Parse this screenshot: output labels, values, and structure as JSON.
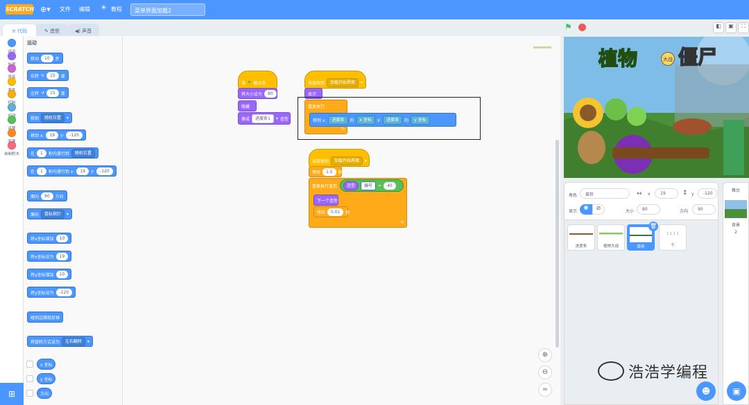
{
  "menubar": {
    "logo": "SCRATCH",
    "file": "文件",
    "edit": "编辑",
    "tutorials": "教程",
    "project_title": "菜单界面加载2"
  },
  "tabs": {
    "code": "代码",
    "costumes": "造型",
    "sounds": "声音"
  },
  "categories": [
    {
      "label": "运动",
      "color": "#4c97ff"
    },
    {
      "label": "外观",
      "color": "#9966ff"
    },
    {
      "label": "声音",
      "color": "#cf63cf"
    },
    {
      "label": "事件",
      "color": "#ffbf00"
    },
    {
      "label": "控制",
      "color": "#ffab19"
    },
    {
      "label": "侦测",
      "color": "#5cb1d6"
    },
    {
      "label": "运算",
      "color": "#59c059"
    },
    {
      "label": "变量",
      "color": "#ff8c1a"
    },
    {
      "label": "自制积木",
      "color": "#ff6680"
    }
  ],
  "palette": {
    "heading": "运动",
    "move": {
      "a": "移动",
      "v": "10",
      "b": "步"
    },
    "turn_r": {
      "a": "右转",
      "v": "15",
      "b": "度"
    },
    "turn_l": {
      "a": "左转",
      "v": "15",
      "b": "度"
    },
    "goto": {
      "a": "移到",
      "dd": "随机位置"
    },
    "goto_xy": {
      "a": "移到 x:",
      "x": "19",
      "b": "y:",
      "y": "-120"
    },
    "glide": {
      "a": "在",
      "v": "1",
      "b": "秒内滑行到",
      "dd": "随机位置"
    },
    "glide_xy": {
      "a": "在",
      "v": "1",
      "b": "秒内滑行到 x:",
      "x": "19",
      "c": "y:",
      "y": "-120"
    },
    "point": {
      "a": "面向",
      "v": "90",
      "b": "方向"
    },
    "point_to": {
      "a": "面向",
      "dd": "鼠标指针"
    },
    "change_x": {
      "a": "将x坐标增加",
      "v": "10"
    },
    "set_x": {
      "a": "将x坐标设为",
      "v": "19"
    },
    "change_y": {
      "a": "将y坐标增加",
      "v": "10"
    },
    "set_y": {
      "a": "将y坐标设为",
      "v": "-120"
    },
    "bounce": "碰到边缘就反弹",
    "rotation": {
      "a": "将旋转方式设为",
      "dd": "左右翻转"
    },
    "rep_x": "x 坐标",
    "rep_y": "y 坐标",
    "rep_dir": "方向"
  },
  "scripts": {
    "s1": {
      "hat": "当",
      "hat2": "被点击",
      "size": "将大小设为",
      "size_v": "80",
      "hide": "隐藏",
      "switch": "换成",
      "switch_dd": "进度条1",
      "switch_b": "造型"
    },
    "s2": {
      "hat": "当接收到",
      "hat_dd": "加载开始界面",
      "show": "显示",
      "forever": "重复执行",
      "goto": "移到 x:",
      "dd1": "进度条",
      "of1": "的",
      "dd2": "x 坐标",
      "y": "y:",
      "dd3": "进度条",
      "of2": "的",
      "dd4": "y 坐标"
    },
    "s3": {
      "hat": "当接收到",
      "hat_dd": "加载开始界面",
      "wait": "等待",
      "wait_v": "1.5",
      "wait_b": "秒",
      "until": "重复执行直到",
      "costume": "造型",
      "costume_dd": "编号",
      "eq": "=",
      "eq_v": "40",
      "next": "下一个造型",
      "wait2": "等待",
      "wait2_v": "0.01",
      "wait2_b": "秒"
    }
  },
  "stage_art": {
    "title": "植物",
    "badge": "大战",
    "title2": "僵尸"
  },
  "sprite_info": {
    "sprite_label": "角色",
    "sprite_name": "菜拌",
    "x_label": "x",
    "x": "19",
    "y_label": "y",
    "y": "-120",
    "show_label": "显示",
    "size_label": "大小",
    "size": "80",
    "dir_label": "方向",
    "dir": "90"
  },
  "sprites": [
    {
      "name": "进度条"
    },
    {
      "name": "植物大战"
    },
    {
      "name": "菜拌"
    },
    {
      "name": "0"
    }
  ],
  "stage_panel": {
    "title": "舞台",
    "bg_label": "背景",
    "bg_count": "2"
  },
  "watermark": "浩浩学编程"
}
